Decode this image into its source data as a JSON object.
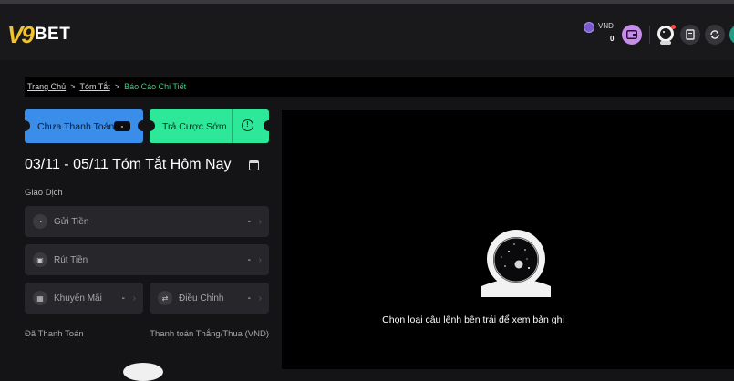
{
  "header": {
    "logo_v": "V9",
    "logo_text": "BET",
    "currency": "VND",
    "balance": "0"
  },
  "breadcrumb": {
    "home": "Trang Chủ",
    "summary": "Tóm Tắt",
    "current": "Báo Cáo Chi Tiết",
    "sep": ">"
  },
  "tickets": {
    "unpaid_label": "Chưa Thanh Toán",
    "unpaid_count": "-",
    "early_label": "Trả Cược Sớm",
    "early_icon": "!"
  },
  "summary": {
    "date_title": "03/11 - 05/11 Tóm Tắt Hôm Nay",
    "section_label": "Giao Dịch",
    "deposit_label": "Gửi Tiền",
    "deposit_value": "-",
    "withdraw_label": "Rút Tiền",
    "withdraw_value": "-",
    "promo_label": "Khuyến Mãi",
    "promo_value": "-",
    "adjust_label": "Điều Chỉnh",
    "adjust_value": "-",
    "paid_label": "Đã Thanh Toán",
    "winloss_label": "Thanh toán Thắng/Thua (VND)"
  },
  "main": {
    "empty_message": "Chọn loại câu lệnh bên trái để xem bản ghi"
  },
  "colors": {
    "accent_green": "#2ed47a",
    "ticket_blue": "#3a8de8",
    "ticket_green": "#2ee89a",
    "logo_gold": "#f2c230"
  }
}
